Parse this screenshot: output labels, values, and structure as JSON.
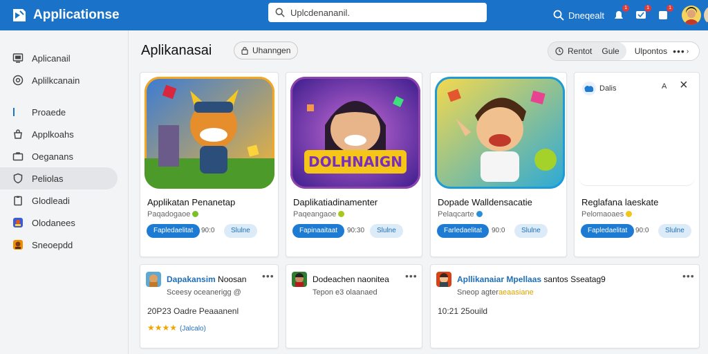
{
  "topbar": {
    "brand": "Applicationse",
    "search_placeholder": "Uplcdenananil.",
    "search_label": "Dneqealt",
    "badges": [
      "1",
      "1",
      "1"
    ],
    "colors": {
      "bar": "#1a73c8"
    }
  },
  "sidebar": {
    "items": [
      {
        "label": "Aplicanail",
        "icon": "monitor-icon"
      },
      {
        "label": "Aplilkcanain",
        "icon": "at-icon"
      },
      {
        "label": "Proaede",
        "icon": "pencil-icon"
      },
      {
        "label": "Applkoahs",
        "icon": "bag-icon"
      },
      {
        "label": "Oeganans",
        "icon": "briefcase-icon"
      },
      {
        "label": "Peliolas",
        "icon": "shield-icon",
        "active": true
      },
      {
        "label": "Glodleadi",
        "icon": "clipboard-icon"
      },
      {
        "label": "Olodanees",
        "icon": "app-icon"
      },
      {
        "label": "Sneoepdd",
        "icon": "avatar-icon"
      }
    ]
  },
  "main": {
    "title": "Aplikanasai",
    "filter_chip": "Uhanngen",
    "segment": {
      "a": "Rentot",
      "b": "Gule",
      "c": "Ulpontos",
      "more": "•••",
      "chevron": "›"
    },
    "cards": [
      {
        "name": "Applikatan Penanetap",
        "sub": "Paqadogaoe",
        "dot_color": "#7bbf2a",
        "install": "Fapledaelitat",
        "num": "90:0",
        "tag": "Slulne"
      },
      {
        "name": "Daplikatiadinamenter",
        "sub": "Paqeangaoe",
        "dot_color": "#a6c81c",
        "install": "Fapinaaitaat",
        "num": "90:30",
        "tag": "Slulne"
      },
      {
        "name": "Dopade Walldensacatie",
        "sub": "Pelaqcarte",
        "dot_color": "#2a8fd8",
        "install": "Farledaelitat",
        "num": "90:0",
        "tag": "Slulne"
      },
      {
        "name": "Reglafana laeskate",
        "sub": "Pelomaoaes",
        "dot_color": "#f2c618",
        "install": "Fapledaelitat",
        "num": "90:0",
        "tag": "Slulne"
      }
    ],
    "panel": {
      "title": "Dalis",
      "a": "A",
      "close": "×"
    },
    "list": [
      {
        "title_hl": "Dapakansim",
        "title_rest": " Noosan",
        "sub": "Sceesy oceanerigg @",
        "line": "20P23 Oadre Peaaanenl",
        "stars": "★★★★",
        "count": "(Jalcalo)",
        "more": "•••"
      },
      {
        "title_hl": "",
        "title_rest": "Dodeachen naonitea",
        "sub": "Tepon e3 olaanaed",
        "line": "",
        "stars": "",
        "count": "",
        "more": "•••"
      },
      {
        "title_hl": "Apllikanaiar Mpellaas",
        "title_rest": "santos Sseatag9",
        "sub_plain": "Sneop agter",
        "sub_hl": "aeaasiane",
        "line": "10:21 25ouild",
        "stars": "",
        "count": "",
        "more": "•••"
      }
    ]
  }
}
